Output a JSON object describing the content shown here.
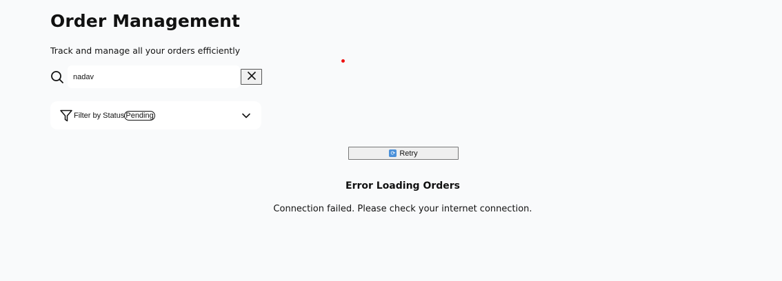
{
  "header": {
    "title": "Order Management",
    "subtitle": "Track and manage all your orders efficiently"
  },
  "search": {
    "value": "nadav",
    "icon": "search-icon",
    "clear_icon": "close-icon"
  },
  "filter": {
    "label": "Filter by Status",
    "selected": "Pending",
    "icon": "filter-icon",
    "expand_icon": "chevron-down-icon"
  },
  "error": {
    "retry_label": "Retry",
    "retry_icon": "refresh-icon",
    "title": "Error Loading Orders",
    "message": "Connection failed. Please check your internet connection."
  },
  "colors": {
    "background": "#f9fafb",
    "card": "#ffffff",
    "indicator": "#e11111",
    "retry_icon": "#4a90d9"
  }
}
